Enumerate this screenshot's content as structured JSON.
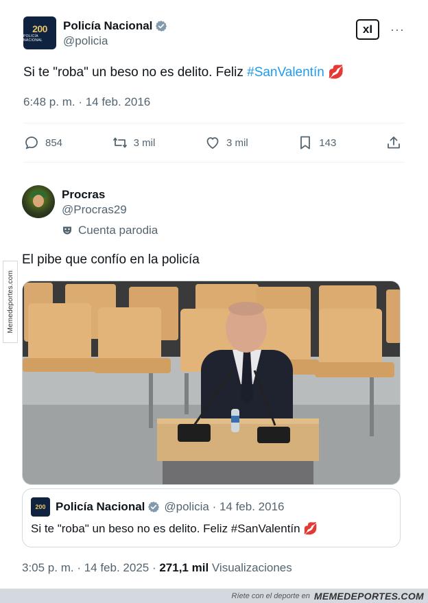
{
  "watermark_side": "Memedeportes.com",
  "tweet1": {
    "avatar_text_num": "200",
    "avatar_text_sub": "POLICÍA NACIONAL",
    "name": "Policía Nacional",
    "handle": "@policia",
    "text_before": "Si te \"roba\" un beso no es delito. Feliz ",
    "hashtag": "#SanValentín",
    "emoji": "💋",
    "time": "6:48 p. m. · 14 feb. 2016",
    "stats": {
      "replies": "854",
      "retweets": "3 mil",
      "likes": "3 mil",
      "bookmarks": "143"
    },
    "top_button": "xI",
    "more": "···"
  },
  "tweet2": {
    "name": "Procras",
    "handle": "@Procras29",
    "parody_label": "Cuenta parodia",
    "text": "El pibe que confío en la policía",
    "quote": {
      "avatar_text": "200",
      "name": "Policía Nacional",
      "handle_date": "@policia · 14 feb. 2016",
      "text": "Si te \"roba\" un beso no es delito. Feliz #SanValentín",
      "emoji": "💋"
    },
    "time_prefix": "3:05 p. m. · 14 feb. 2025 · ",
    "views_count": "271,1 mil",
    "views_label": " Visualizaciones"
  },
  "footer": {
    "tagline": "Ríete con el deporte en",
    "brand": "MEMEDEPORTES.COM"
  },
  "colors": {
    "accent": "#1d9bf0",
    "verified": "#829aab",
    "muted": "#536471"
  }
}
